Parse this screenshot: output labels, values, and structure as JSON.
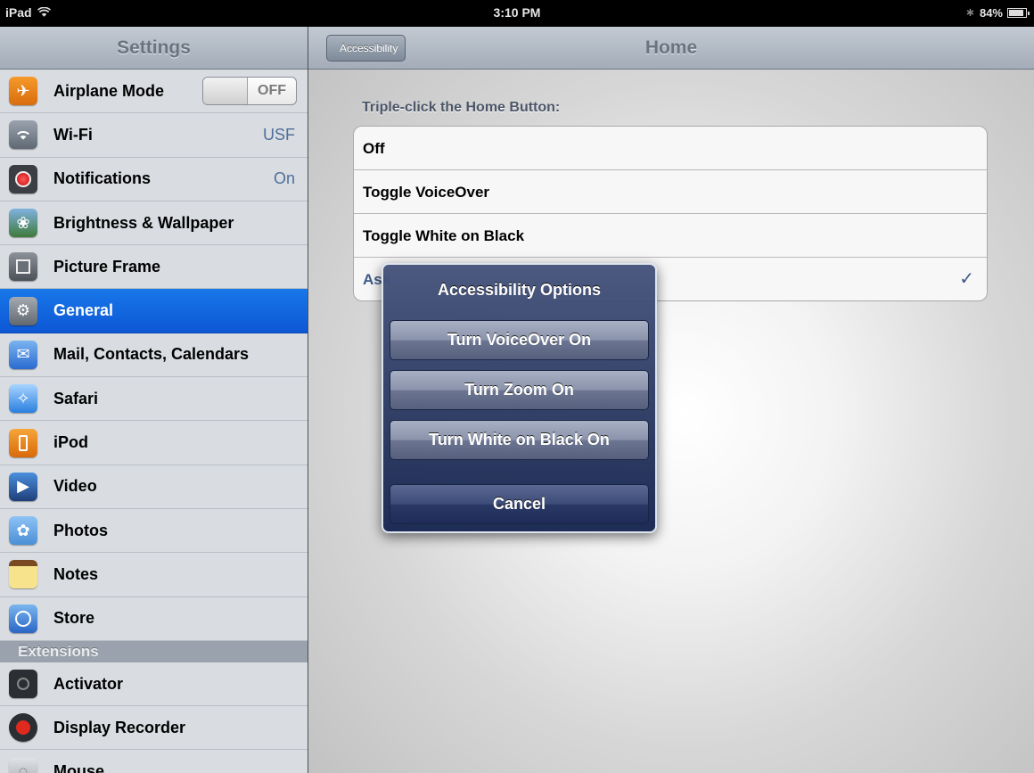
{
  "status_bar": {
    "device": "iPad",
    "time": "3:10 PM",
    "battery": "84%"
  },
  "settings": {
    "title": "Settings",
    "items": [
      {
        "label": "Airplane Mode",
        "icon": "airplane-icon",
        "toggle": "OFF"
      },
      {
        "label": "Wi-Fi",
        "icon": "wifi-icon",
        "value": "USF"
      },
      {
        "label": "Notifications",
        "icon": "notifications-icon",
        "value": "On"
      },
      {
        "label": "Brightness & Wallpaper",
        "icon": "wallpaper-icon"
      },
      {
        "label": "Picture Frame",
        "icon": "picture-frame-icon"
      },
      {
        "label": "General",
        "icon": "gear-icon",
        "selected": true
      },
      {
        "label": "Mail, Contacts, Calendars",
        "icon": "mail-icon"
      },
      {
        "label": "Safari",
        "icon": "safari-compass-icon"
      },
      {
        "label": "iPod",
        "icon": "ipod-icon"
      },
      {
        "label": "Video",
        "icon": "video-clapper-icon"
      },
      {
        "label": "Photos",
        "icon": "photos-sunflower-icon"
      },
      {
        "label": "Notes",
        "icon": "notes-icon"
      },
      {
        "label": "Store",
        "icon": "store-icon"
      }
    ],
    "section_header": "Extensions",
    "extensions": [
      {
        "label": "Activator",
        "icon": "activator-icon"
      },
      {
        "label": "Display Recorder",
        "icon": "record-icon"
      },
      {
        "label": "Mouse",
        "icon": "mouse-icon"
      }
    ]
  },
  "detail": {
    "back_label": "Accessibility",
    "title": "Home",
    "group_header": "Triple-click the Home Button:",
    "options": [
      {
        "label": "Off"
      },
      {
        "label": "Toggle VoiceOver"
      },
      {
        "label": "Toggle White on Black"
      },
      {
        "label": "Ask",
        "checked": true
      }
    ],
    "check_mark": "✓"
  },
  "alert": {
    "title": "Accessibility Options",
    "buttons": [
      "Turn VoiceOver On",
      "Turn Zoom On",
      "Turn White on Black On"
    ],
    "cancel": "Cancel"
  },
  "colors": {
    "selected_row": "#1877e8",
    "check": "#3d5a86",
    "alert_bg": "#2a3866"
  }
}
